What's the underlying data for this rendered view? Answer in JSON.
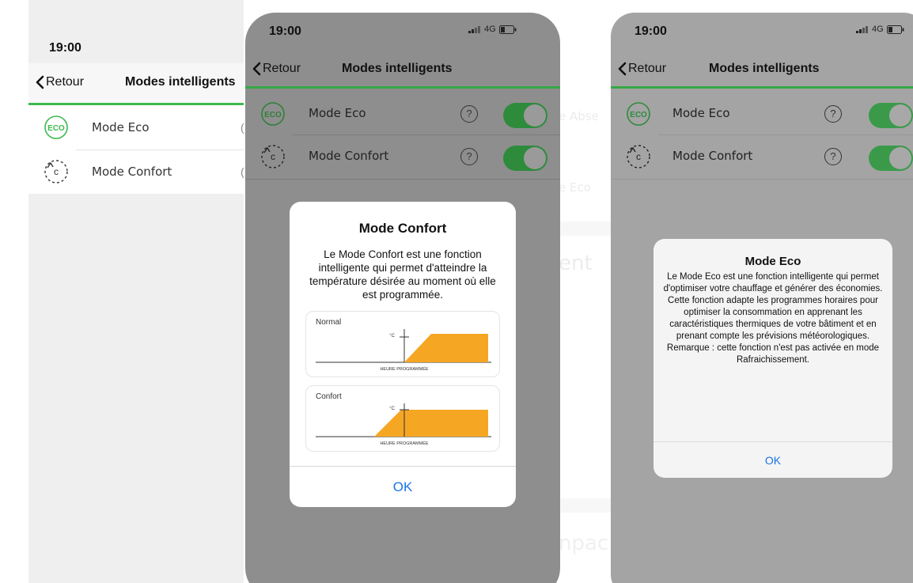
{
  "phone1": {
    "time": "19:00",
    "back_label": "Retour",
    "title": "Modes intelligents",
    "rows": [
      {
        "label": "Mode Eco",
        "icon_text": "ECO",
        "q": "("
      },
      {
        "label": "Mode Confort",
        "icon_text": "c",
        "q": "("
      }
    ]
  },
  "phone2": {
    "time": "19:00",
    "network": "4G",
    "back_label": "Retour",
    "title": "Modes intelligents",
    "rows": [
      {
        "label": "Mode Eco",
        "icon_text": "ECO",
        "help": "?",
        "toggle_on": true
      },
      {
        "label": "Mode Confort",
        "icon_text": "c",
        "help": "?",
        "toggle_on": true
      }
    ],
    "dialog": {
      "title": "Mode Confort",
      "body": "Le Mode Confort est une fonction intelligente qui permet d'atteindre la température désirée au moment où elle est programmée.",
      "graphs": [
        {
          "label": "Normal",
          "unit": "°C",
          "axis_label": "HEURE PROGRAMMÉE"
        },
        {
          "label": "Confort",
          "unit": "°C",
          "axis_label": "HEURE PROGRAMMÉE"
        }
      ],
      "ok_label": "OK"
    }
  },
  "phone3": {
    "time": "19:00",
    "network": "4G",
    "back_label": "Retour",
    "title": "Modes intelligents",
    "rows": [
      {
        "label": "Mode Eco",
        "icon_text": "ECO",
        "help": "?",
        "toggle_on": true
      },
      {
        "label": "Mode Confort",
        "icon_text": "c",
        "help": "?",
        "toggle_on": true
      }
    ],
    "dialog": {
      "title": "Mode Eco",
      "body": "Le Mode Eco est une fonction intelligente qui permet d'optimiser votre chauffage et générer des économies. Cette fonction adapte les programmes horaires pour optimiser la consommation en apprenant les caractéristiques thermiques de votre bâtiment et en prenant compte les prévisions météorologiques. Remarque : cette fonction n'est pas activée en mode Rafraichissement.",
      "ok_label": "OK"
    }
  },
  "background": {
    "fragments": [
      "e Abse",
      "e Eco",
      "ent",
      "npac"
    ]
  },
  "colors": {
    "accent_green": "#3dba4e",
    "link_blue": "#1a73e8",
    "graph_orange": "#f5a623"
  }
}
